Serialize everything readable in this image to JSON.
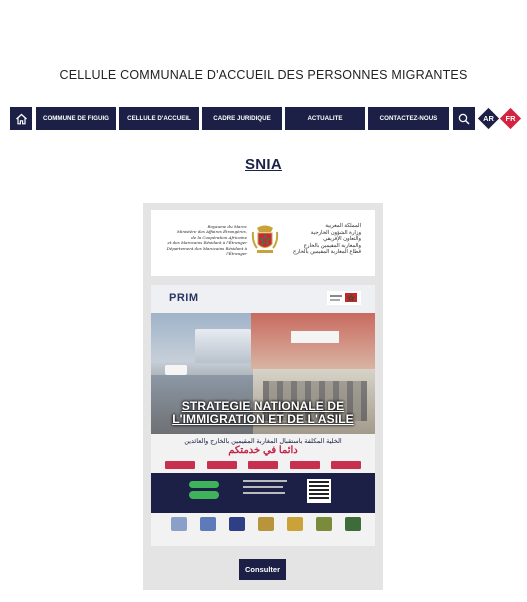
{
  "header": {
    "site_title": "CELLULE COMMUNALE D'ACCUEIL DES PERSONNES MIGRANTES"
  },
  "nav": {
    "home_icon": "home-icon",
    "items": [
      {
        "label": "COMMUNE DE FIGUIG"
      },
      {
        "label": "CELLULE D'ACCUEIL"
      },
      {
        "label": "CADRE JURIDIQUE"
      },
      {
        "label": "ACTUALITE"
      },
      {
        "label": "CONTACTEZ-NOUS"
      }
    ],
    "search_icon": "search-icon",
    "languages": [
      {
        "code": "AR",
        "color": "#1c2046"
      },
      {
        "code": "FR",
        "color": "#d4233f"
      }
    ]
  },
  "page": {
    "title": "SNIA"
  },
  "card": {
    "logo_fr": "Royaume du Maroc\nMinistère des Affaires Étrangères,\nde la Coopération Africaine\net des Marocains Résidant à l'Étranger\nDépartement des Marocains Résidant à l'Étranger",
    "logo_ar": "المملكة المغربية\nوزارة الشؤون الخارجية\nوالتعاون الإفريقي\nوالمغاربة المقيمين بالخارج\nقطاع المغاربة المقيمين بالخارج",
    "poster": {
      "brand": "PRIM",
      "title": "STRATEGIE NATIONALE DE L'IMMIGRATION ET DE L'ASILE",
      "arabic_line": "الخلية المكلفة باستقبال المغاربة المقيمين بالخارج والعائدين",
      "arabic_slogan": "دائما في خدمتكم"
    },
    "button_label": "Consulter"
  },
  "colors": {
    "navy": "#1c2046",
    "red": "#d4233f",
    "card_bg": "#e4e4e4"
  }
}
